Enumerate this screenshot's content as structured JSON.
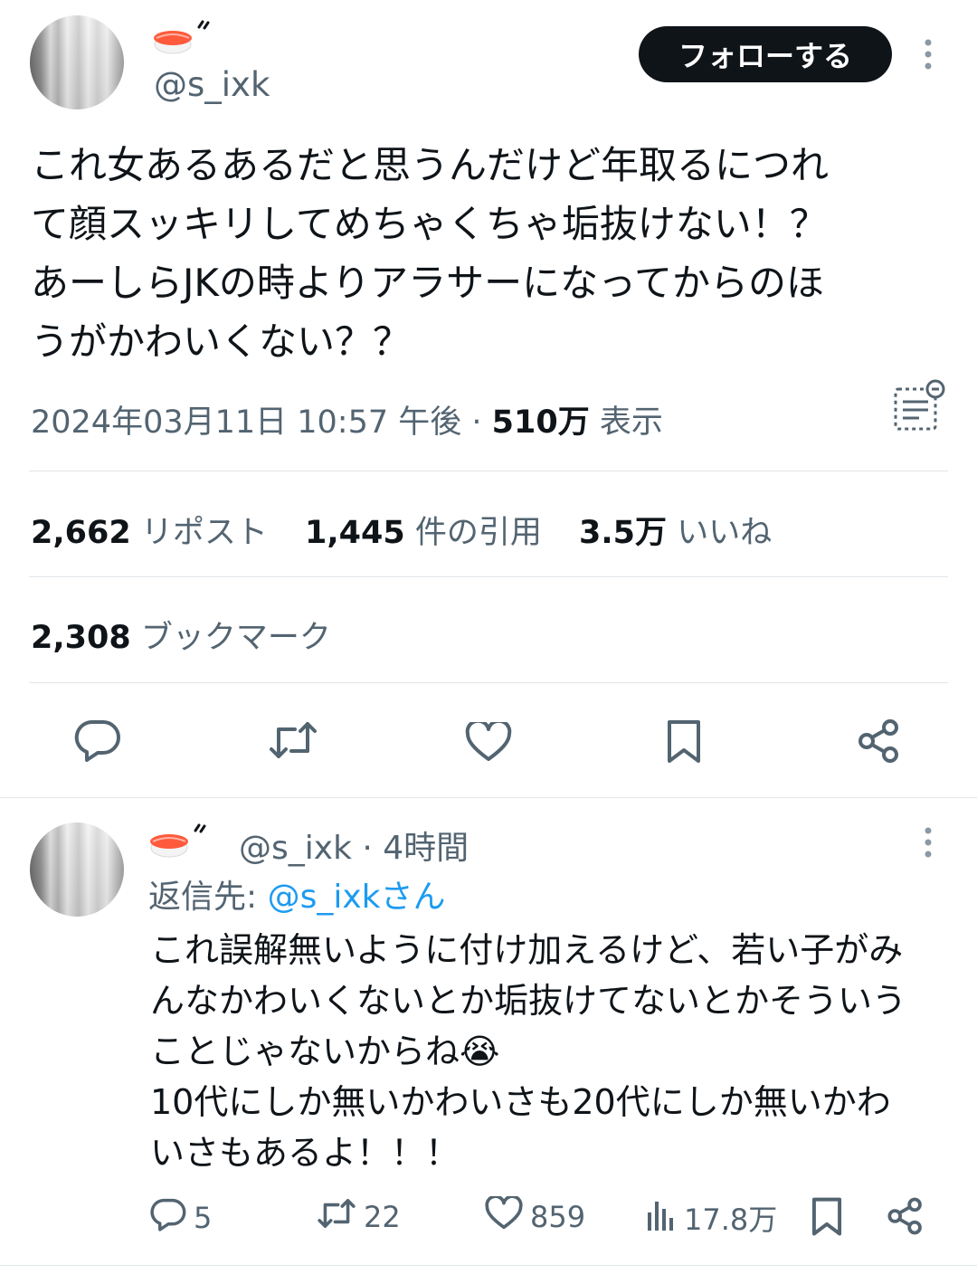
{
  "tweet": {
    "handle": "@s_ixk",
    "follow_label": "フォローする",
    "text_lines": [
      "これ女あるあるだと思うんだけど年取るにつれ",
      "て顔スッキリしてめちゃくちゃ垢抜けない！？",
      "あーしらJKの時よりアラサーになってからのほ",
      "うがかわいくない？？"
    ],
    "timestamp": "2024年03月11日 10:57 午後 · ",
    "views_count": "510万",
    "views_label": " 表示",
    "stats": {
      "reposts_count": "2,662",
      "reposts_label": "リポスト",
      "quotes_count": "1,445",
      "quotes_label": "件の引用",
      "likes_count": "3.5万",
      "likes_label": "いいね",
      "bookmarks_count": "2,308",
      "bookmarks_label": "ブックマーク"
    }
  },
  "reply": {
    "handle": "@s_ixk",
    "time": " · 4時間",
    "reply_to_prefix": "返信先: ",
    "reply_to_handle": "@s_ixkさん",
    "text_lines": [
      "これ誤解無いように付け加えるけど、若い子がみ",
      "んなかわいくないとか垢抜けてないとかそういう",
      "ことじゃないからね😭",
      "10代にしか無いかわいさも20代にしか無いかわ",
      "いさもあるよ！！！"
    ],
    "actions": {
      "replies": "5",
      "reposts": "22",
      "likes": "859",
      "views": "17.8万"
    }
  },
  "colors": {
    "text": "#0f1419",
    "secondary": "#536471",
    "link": "#1d9bf0",
    "divider": "#e1e6ea",
    "follow_bg": "#0f1419"
  },
  "icons": [
    "sushi-emoji",
    "more-icon",
    "summary-icon",
    "reply-icon",
    "repost-icon",
    "like-icon",
    "bookmark-icon",
    "share-icon",
    "views-icon"
  ]
}
